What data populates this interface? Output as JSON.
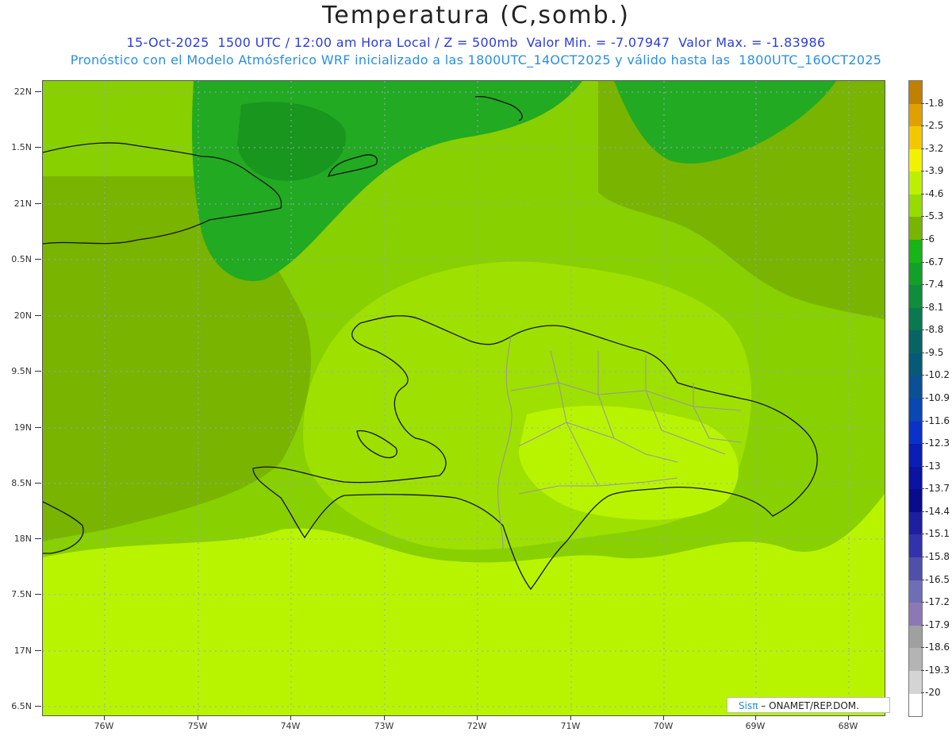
{
  "title": "Temperatura (C,somb.)",
  "subtitle_line1": "15-Oct-2025  1500 UTC / 12:00 am Hora Local / Z = 500mb  Valor Min. = -7.07947  Valor Max. = -1.83986",
  "subtitle_line2": "Pronóstico con el Modelo Atmósferico WRF inicializado a las 1800UTC_14OCT2025 y válido hasta las  1800UTC_16OCT2025",
  "lat_labels": [
    "22N",
    "1.5N",
    "21N",
    "0.5N",
    "20N",
    "9.5N",
    "19N",
    "8.5N",
    "18N",
    "7.5N",
    "17N",
    "6.5N"
  ],
  "lon_labels": [
    "76W",
    "75W",
    "74W",
    "73W",
    "72W",
    "71W",
    "70W",
    "69W",
    "68W"
  ],
  "colorbar": {
    "labels": [
      "-1.8",
      "-2.5",
      "-3.2",
      "-3.9",
      "-4.6",
      "-5.3",
      "-6",
      "-6.7",
      "-7.4",
      "-8.1",
      "-8.8",
      "-9.5",
      "-10.2",
      "-10.9",
      "-11.6",
      "-12.3",
      "-13",
      "-13.7",
      "-14.4",
      "-15.1",
      "-15.8",
      "-16.5",
      "-17.2",
      "-17.9",
      "-18.6",
      "-19.3",
      "-20"
    ],
    "colors": [
      "#c08000",
      "#e0a000",
      "#f4c800",
      "#f2f200",
      "#bcf000",
      "#96dc00",
      "#78b400",
      "#18b418",
      "#12a028",
      "#0f8c3c",
      "#0a7850",
      "#086464",
      "#065a78",
      "#0a5096",
      "#0a46b4",
      "#0a32c8",
      "#0a1eb4",
      "#0a14a0",
      "#0a0a8c",
      "#1e1ea0",
      "#3232aa",
      "#5050aa",
      "#6e6eb4",
      "#8c78b4",
      "#a0a0a0",
      "#b4b4b4",
      "#d4d4d4"
    ]
  },
  "field_colors": {
    "very_light": "#b8f400",
    "light": "#9ee000",
    "mid": "#88d000",
    "olive": "#78b400",
    "green": "#22aa22",
    "dark_green": "#18961e"
  },
  "credit": {
    "brand": "Sisπ",
    "text": "– ONAMET/REP.DOM."
  }
}
